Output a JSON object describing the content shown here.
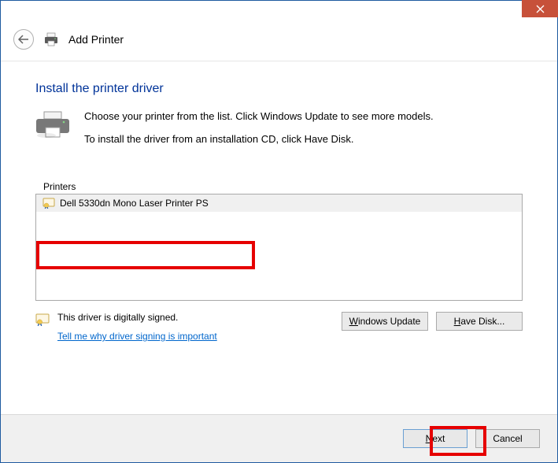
{
  "header": {
    "title": "Add Printer"
  },
  "section": {
    "heading": "Install the printer driver",
    "line1": "Choose your printer from the list. Click Windows Update to see more models.",
    "line2": "To install the driver from an installation CD, click Have Disk."
  },
  "list": {
    "label": "Printers",
    "items": [
      {
        "name": "Dell 5330dn Mono Laser Printer PS"
      }
    ]
  },
  "signing": {
    "status": "This driver is digitally signed.",
    "link": "Tell me why driver signing is important"
  },
  "buttons": {
    "update": "Windows Update",
    "update_acc": "W",
    "havedisk": "Have Disk...",
    "havedisk_acc": "H",
    "next": "Next",
    "next_acc": "N",
    "cancel": "Cancel"
  }
}
